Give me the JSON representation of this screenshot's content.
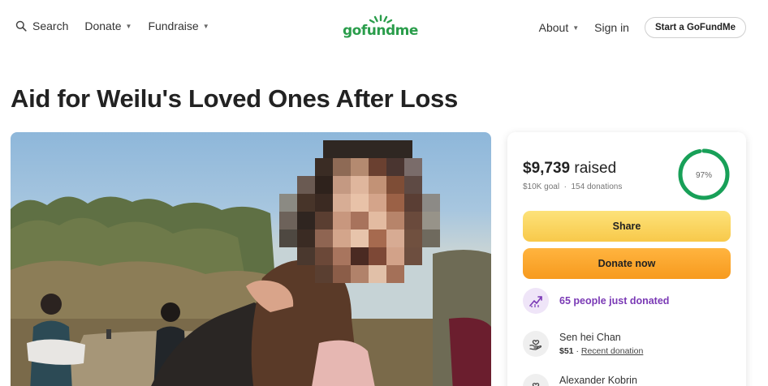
{
  "header": {
    "search_label": "Search",
    "donate_label": "Donate",
    "fundraise_label": "Fundraise",
    "logo_text": "gofundme",
    "about_label": "About",
    "signin_label": "Sign in",
    "start_label": "Start a GoFundMe"
  },
  "page": {
    "title": "Aid for Weilu's Loved Ones After Loss"
  },
  "card": {
    "raised_amount": "$9,739",
    "raised_suffix": " raised",
    "goal": "$10K goal",
    "donations": "154 donations",
    "progress_label": "97%",
    "progress_fraction": 0.97,
    "share_label": "Share",
    "donate_now_label": "Donate now",
    "just_donated": "65 people just donated",
    "donors": [
      {
        "name": "Sen hei Chan",
        "amount": "$51",
        "note": "Recent donation"
      },
      {
        "name": "Alexander Kobrin"
      }
    ]
  },
  "colors": {
    "brand_green": "#2a9d4b",
    "share_yellow": "#f8c94a",
    "donate_orange": "#f79a1e",
    "purple_text": "#7a39b5"
  },
  "icons": [
    "search-icon",
    "caret-down-icon",
    "sunburst-logo-icon",
    "trend-up-icon",
    "hands-heart-icon"
  ]
}
